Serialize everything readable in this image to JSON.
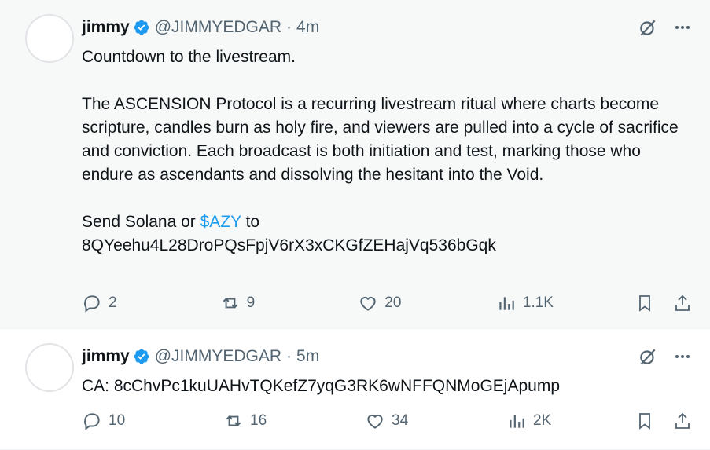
{
  "tweets": [
    {
      "author_name": "jimmy",
      "handle": "@JIMMYEDGAR",
      "separator": "·",
      "time": "4m",
      "lines": [
        "Countdown to the livestream.",
        "",
        "The ASCENSION Protocol is a recurring livestream ritual where charts become scripture, candles burn as holy fire, and viewers are pulled into a cycle of sacrifice and conviction. Each broadcast is both initiation and test, marking those who endure as ascendants and dissolving the hesitant into the Void.",
        ""
      ],
      "send_prefix": "Send Solana or ",
      "cashtag": "$AZY",
      "send_suffix": " to",
      "address": "8QYeehu4L28DroPQsFpjV6rX3xCKGfZEHajVq536bGqk",
      "replies": "2",
      "reposts": "9",
      "likes": "20",
      "views": "1.1K"
    },
    {
      "author_name": "jimmy",
      "handle": "@JIMMYEDGAR",
      "separator": "·",
      "time": "5m",
      "text": "CA: 8cChvPc1kuUAHvTQKefZ7yqG3RK6wNFFQNMoGEjApump",
      "replies": "10",
      "reposts": "16",
      "likes": "34",
      "views": "2K"
    }
  ],
  "colors": {
    "accent": "#1d9bf0",
    "muted": "#536471",
    "text": "#0f1419",
    "highlight_bg": "#f7f9f9"
  },
  "icons": [
    "verified-badge-icon",
    "grok-icon",
    "more-icon",
    "reply-icon",
    "repost-icon",
    "like-icon",
    "views-icon",
    "bookmark-icon",
    "share-icon"
  ]
}
